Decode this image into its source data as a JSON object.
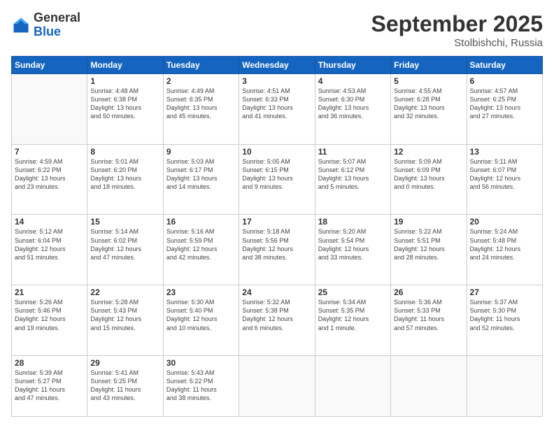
{
  "header": {
    "logo": {
      "line1": "General",
      "line2": "Blue"
    },
    "title": "September 2025",
    "subtitle": "Stolbishchi, Russia"
  },
  "weekdays": [
    "Sunday",
    "Monday",
    "Tuesday",
    "Wednesday",
    "Thursday",
    "Friday",
    "Saturday"
  ],
  "weeks": [
    [
      {
        "day": "",
        "info": ""
      },
      {
        "day": "1",
        "info": "Sunrise: 4:48 AM\nSunset: 6:38 PM\nDaylight: 13 hours\nand 50 minutes."
      },
      {
        "day": "2",
        "info": "Sunrise: 4:49 AM\nSunset: 6:35 PM\nDaylight: 13 hours\nand 45 minutes."
      },
      {
        "day": "3",
        "info": "Sunrise: 4:51 AM\nSunset: 6:33 PM\nDaylight: 13 hours\nand 41 minutes."
      },
      {
        "day": "4",
        "info": "Sunrise: 4:53 AM\nSunset: 6:30 PM\nDaylight: 13 hours\nand 36 minutes."
      },
      {
        "day": "5",
        "info": "Sunrise: 4:55 AM\nSunset: 6:28 PM\nDaylight: 13 hours\nand 32 minutes."
      },
      {
        "day": "6",
        "info": "Sunrise: 4:57 AM\nSunset: 6:25 PM\nDaylight: 13 hours\nand 27 minutes."
      }
    ],
    [
      {
        "day": "7",
        "info": "Sunrise: 4:59 AM\nSunset: 6:22 PM\nDaylight: 13 hours\nand 23 minutes."
      },
      {
        "day": "8",
        "info": "Sunrise: 5:01 AM\nSunset: 6:20 PM\nDaylight: 13 hours\nand 18 minutes."
      },
      {
        "day": "9",
        "info": "Sunrise: 5:03 AM\nSunset: 6:17 PM\nDaylight: 13 hours\nand 14 minutes."
      },
      {
        "day": "10",
        "info": "Sunrise: 5:05 AM\nSunset: 6:15 PM\nDaylight: 13 hours\nand 9 minutes."
      },
      {
        "day": "11",
        "info": "Sunrise: 5:07 AM\nSunset: 6:12 PM\nDaylight: 13 hours\nand 5 minutes."
      },
      {
        "day": "12",
        "info": "Sunrise: 5:09 AM\nSunset: 6:09 PM\nDaylight: 13 hours\nand 0 minutes."
      },
      {
        "day": "13",
        "info": "Sunrise: 5:11 AM\nSunset: 6:07 PM\nDaylight: 12 hours\nand 56 minutes."
      }
    ],
    [
      {
        "day": "14",
        "info": "Sunrise: 5:12 AM\nSunset: 6:04 PM\nDaylight: 12 hours\nand 51 minutes."
      },
      {
        "day": "15",
        "info": "Sunrise: 5:14 AM\nSunset: 6:02 PM\nDaylight: 12 hours\nand 47 minutes."
      },
      {
        "day": "16",
        "info": "Sunrise: 5:16 AM\nSunset: 5:59 PM\nDaylight: 12 hours\nand 42 minutes."
      },
      {
        "day": "17",
        "info": "Sunrise: 5:18 AM\nSunset: 5:56 PM\nDaylight: 12 hours\nand 38 minutes."
      },
      {
        "day": "18",
        "info": "Sunrise: 5:20 AM\nSunset: 5:54 PM\nDaylight: 12 hours\nand 33 minutes."
      },
      {
        "day": "19",
        "info": "Sunrise: 5:22 AM\nSunset: 5:51 PM\nDaylight: 12 hours\nand 28 minutes."
      },
      {
        "day": "20",
        "info": "Sunrise: 5:24 AM\nSunset: 5:48 PM\nDaylight: 12 hours\nand 24 minutes."
      }
    ],
    [
      {
        "day": "21",
        "info": "Sunrise: 5:26 AM\nSunset: 5:46 PM\nDaylight: 12 hours\nand 19 minutes."
      },
      {
        "day": "22",
        "info": "Sunrise: 5:28 AM\nSunset: 5:43 PM\nDaylight: 12 hours\nand 15 minutes."
      },
      {
        "day": "23",
        "info": "Sunrise: 5:30 AM\nSunset: 5:40 PM\nDaylight: 12 hours\nand 10 minutes."
      },
      {
        "day": "24",
        "info": "Sunrise: 5:32 AM\nSunset: 5:38 PM\nDaylight: 12 hours\nand 6 minutes."
      },
      {
        "day": "25",
        "info": "Sunrise: 5:34 AM\nSunset: 5:35 PM\nDaylight: 12 hours\nand 1 minute."
      },
      {
        "day": "26",
        "info": "Sunrise: 5:36 AM\nSunset: 5:33 PM\nDaylight: 11 hours\nand 57 minutes."
      },
      {
        "day": "27",
        "info": "Sunrise: 5:37 AM\nSunset: 5:30 PM\nDaylight: 11 hours\nand 52 minutes."
      }
    ],
    [
      {
        "day": "28",
        "info": "Sunrise: 5:39 AM\nSunset: 5:27 PM\nDaylight: 11 hours\nand 47 minutes."
      },
      {
        "day": "29",
        "info": "Sunrise: 5:41 AM\nSunset: 5:25 PM\nDaylight: 11 hours\nand 43 minutes."
      },
      {
        "day": "30",
        "info": "Sunrise: 5:43 AM\nSunset: 5:22 PM\nDaylight: 11 hours\nand 38 minutes."
      },
      {
        "day": "",
        "info": ""
      },
      {
        "day": "",
        "info": ""
      },
      {
        "day": "",
        "info": ""
      },
      {
        "day": "",
        "info": ""
      }
    ]
  ]
}
